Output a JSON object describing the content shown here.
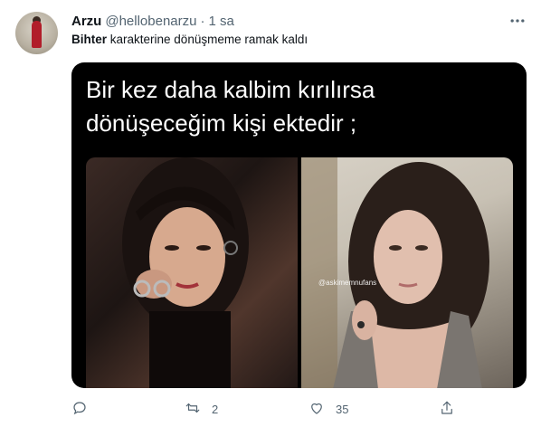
{
  "tweet": {
    "author_name": "Arzu",
    "author_handle": "@hellobenarzu",
    "separator": "·",
    "timestamp": "1 sa",
    "text_bold": "Bihter",
    "text_rest": " karakterine dönüşmeme ramak kaldı",
    "media": {
      "caption": "Bir kez daha kalbim kırılırsa dönüşeceğim kişi ektedir ;",
      "watermark": "@askimemnufans"
    },
    "actions": {
      "reply_count": "",
      "retweet_count": "2",
      "like_count": "35"
    }
  },
  "icons": {
    "more": "more-icon",
    "reply": "reply-icon",
    "retweet": "retweet-icon",
    "like": "heart-icon",
    "share": "share-icon"
  },
  "colors": {
    "secondary_text": "#536471",
    "primary_text": "#0f1419",
    "media_background": "#000000"
  }
}
